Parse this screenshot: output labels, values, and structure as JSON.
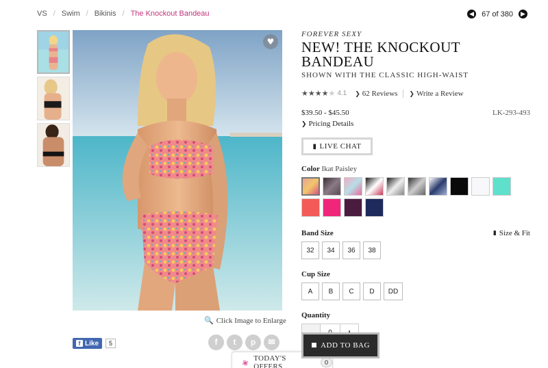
{
  "breadcrumb": {
    "items": [
      "VS",
      "Swim",
      "Bikinis"
    ],
    "current": "The Knockout Bandeau"
  },
  "pager": {
    "text": "67 of 380",
    "prev_icon": "chevron-left-icon",
    "next_icon": "chevron-right-icon"
  },
  "product": {
    "brand": "FOREVER SEXY",
    "title": "NEW! THE KNOCKOUT BANDEAU",
    "subtitle": "SHOWN WITH THE CLASSIC HIGH-WAIST",
    "rating": 4.1,
    "rating_text": "4.1",
    "reviews": "62 Reviews",
    "write_review": "Write a Review",
    "price": "$39.50 - $45.50",
    "sku": "LK-293-493",
    "pricing_details": "Pricing Details"
  },
  "live_chat": {
    "label": "LIVE CHAT"
  },
  "color": {
    "label": "Color",
    "selected": "Ikat Paisley",
    "swatches": [
      {
        "name": "ikat-paisley",
        "colors": [
          "#e8a39a",
          "#f2c66a",
          "#d9577f"
        ]
      },
      {
        "name": "animal-print",
        "colors": [
          "#3a2e35",
          "#8a7a86",
          "#5a4a56"
        ]
      },
      {
        "name": "floral-pink",
        "colors": [
          "#f4a9c6",
          "#b6dfe7",
          "#e86a9c"
        ]
      },
      {
        "name": "stripe",
        "colors": [
          "#1a1a1a",
          "#ffffff",
          "#c93a5a"
        ]
      },
      {
        "name": "metallic",
        "colors": [
          "#222222",
          "#eeeeee",
          "#888888"
        ]
      },
      {
        "name": "black-white-print",
        "colors": [
          "#333333",
          "#cccccc",
          "#666666"
        ]
      },
      {
        "name": "navy-ikat",
        "colors": [
          "#ffffff",
          "#2a3c6e",
          "#9fb0d6"
        ]
      },
      {
        "name": "black",
        "colors": [
          "#0a0a0a"
        ]
      },
      {
        "name": "white",
        "colors": [
          "#f8f8fb"
        ]
      },
      {
        "name": "turquoise",
        "colors": [
          "#5fe0cc"
        ]
      },
      {
        "name": "coral",
        "colors": [
          "#f25b58"
        ]
      },
      {
        "name": "hot-pink",
        "colors": [
          "#f0267a"
        ]
      },
      {
        "name": "plum",
        "colors": [
          "#4a1d40"
        ]
      },
      {
        "name": "navy",
        "colors": [
          "#1d2a5c"
        ]
      }
    ]
  },
  "band_size": {
    "label": "Band Size",
    "size_fit": "Size & Fit",
    "options": [
      "32",
      "34",
      "36",
      "38"
    ]
  },
  "cup_size": {
    "label": "Cup Size",
    "options": [
      "A",
      "B",
      "C",
      "D",
      "DD"
    ]
  },
  "quantity": {
    "label": "Quantity",
    "value": "0",
    "minus": "−",
    "plus": "+"
  },
  "add_to_bag": {
    "label": "ADD TO BAG"
  },
  "image": {
    "enlarge": "Click Image to Enlarge"
  },
  "social": {
    "fb_like": "Like",
    "fb_count": "5",
    "icons": [
      "facebook-icon",
      "twitter-icon",
      "pinterest-icon",
      "email-icon"
    ]
  },
  "offers": {
    "label": "TODAY'S OFFERS",
    "count": "0"
  }
}
